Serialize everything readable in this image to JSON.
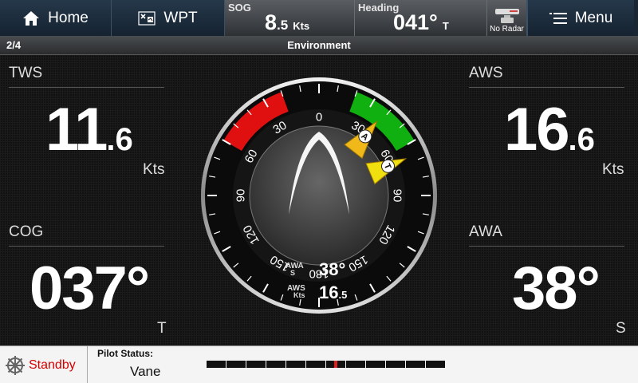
{
  "topbar": {
    "home_label": "Home",
    "wpt_label": "WPT",
    "sog": {
      "label": "SOG",
      "value_int": "8",
      "value_dec": ".5",
      "unit": "Kts"
    },
    "heading": {
      "label": "Heading",
      "value": "041°",
      "ref": "T"
    },
    "radar_label": "No Radar",
    "menu_label": "Menu"
  },
  "titlebar": {
    "page": "2/4",
    "title": "Environment"
  },
  "panels": {
    "tws": {
      "label": "TWS",
      "value_int": "11",
      "value_dec": ".6",
      "unit": "Kts"
    },
    "cog": {
      "label": "COG",
      "value": "037°",
      "unit": "T"
    },
    "aws": {
      "label": "AWS",
      "value_int": "16",
      "value_dec": ".6",
      "unit": "Kts"
    },
    "awa": {
      "label": "AWA",
      "value": "38°",
      "unit": "S"
    }
  },
  "gauge": {
    "scale_labels": [
      "0",
      "30",
      "60",
      "90",
      "120",
      "150",
      "180",
      "150",
      "120",
      "90",
      "60",
      "30"
    ],
    "apparent_marker": "A",
    "true_marker": "T",
    "apparent_angle_deg": 38,
    "true_angle_deg": 67,
    "center": {
      "awa_label": "AWA",
      "awa_side": "S",
      "awa_value": "38°",
      "aws_label": "AWS",
      "aws_unit": "Kts",
      "aws_value_int": "16",
      "aws_value_dec": ".5"
    },
    "colors": {
      "port_sector": "#e01010",
      "starboard_sector": "#10b010",
      "apparent_marker": "#f0b818",
      "true_marker": "#f0e010"
    }
  },
  "bottombar": {
    "standby_label": "Standby",
    "pilot_status_label": "Pilot Status:",
    "pilot_status_value": "Vane"
  },
  "rudder_indicator": {
    "segments": 12,
    "position_fraction": 0.5,
    "marker_color": "#e02020"
  }
}
